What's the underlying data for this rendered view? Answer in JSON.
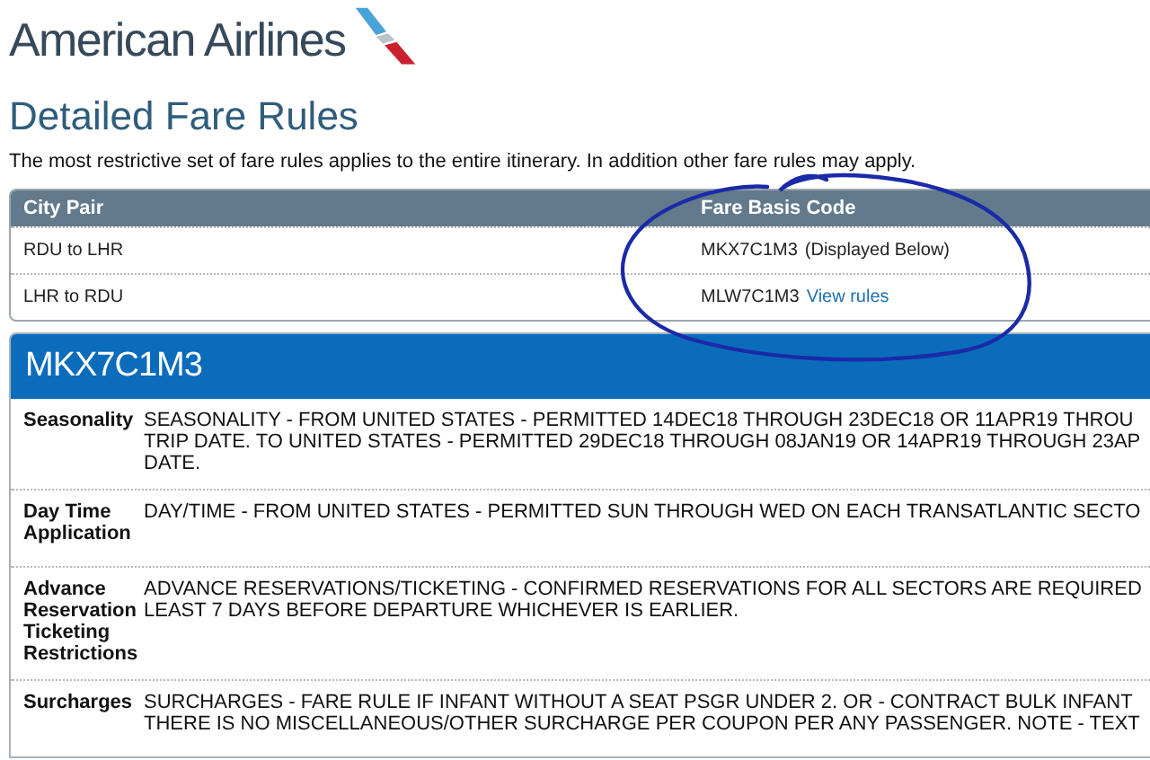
{
  "brand": {
    "name": "American Airlines"
  },
  "page_title": "Detailed Fare Rules",
  "intro": "The most restrictive set of fare rules applies to the entire itinerary. In addition other fare rules may apply.",
  "city_table": {
    "columns": [
      "City Pair",
      "Fare Basis Code"
    ],
    "rows": [
      {
        "city_pair": "RDU to  LHR",
        "fare_basis": "MKX7C1M3",
        "note": "(Displayed Below)",
        "link": ""
      },
      {
        "city_pair": "LHR to  RDU",
        "fare_basis": "MLW7C1M3",
        "note": "",
        "link": "View rules"
      }
    ]
  },
  "rules_panel": {
    "title": "MKX7C1M3",
    "rules": [
      {
        "label": "Seasonality",
        "lines": [
          "SEASONALITY - FROM UNITED STATES - PERMITTED 14DEC18 THROUGH 23DEC18 OR 11APR19 THROU",
          "TRIP DATE. TO UNITED STATES - PERMITTED 29DEC18 THROUGH 08JAN19 OR 14APR19 THROUGH 23AP",
          "DATE."
        ]
      },
      {
        "label": "Day Time Application",
        "lines": [
          "DAY/TIME - FROM UNITED STATES - PERMITTED SUN THROUGH WED ON EACH TRANSATLANTIC SECTO"
        ]
      },
      {
        "label": "Advance Reservation Ticketing Restrictions",
        "lines": [
          "ADVANCE RESERVATIONS/TICKETING - CONFIRMED RESERVATIONS FOR ALL SECTORS ARE REQUIRED",
          "LEAST 7 DAYS BEFORE DEPARTURE WHICHEVER IS EARLIER."
        ]
      },
      {
        "label": "Surcharges",
        "lines": [
          "SURCHARGES - FARE RULE IF INFANT WITHOUT A SEAT PSGR UNDER 2. OR - CONTRACT BULK INFANT",
          "THERE IS NO MISCELLANEOUS/OTHER SURCHARGE PER COUPON PER ANY PASSENGER. NOTE - TEXT"
        ]
      }
    ]
  }
}
